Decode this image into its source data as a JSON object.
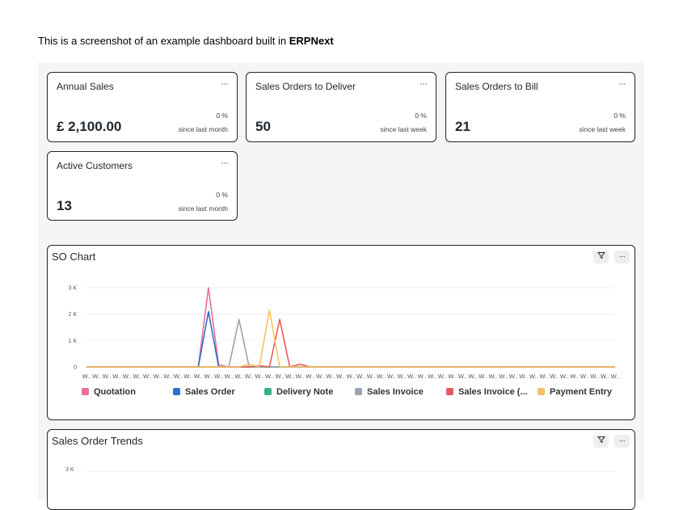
{
  "intro": {
    "prefix": "This is a screenshot of an example dashboard built in ",
    "brand": "ERPNext"
  },
  "cards": [
    {
      "title": "Annual Sales",
      "value": "£ 2,100.00",
      "change": "0 %",
      "period": "since last month",
      "menu": "···"
    },
    {
      "title": "Sales Orders to Deliver",
      "value": "50",
      "change": "0 %",
      "period": "since last week",
      "menu": "···"
    },
    {
      "title": "Sales Orders to Bill",
      "value": "21",
      "change": "0 %",
      "period": "since last week",
      "menu": "···"
    },
    {
      "title": "Active Customers",
      "value": "13",
      "change": "0 %",
      "period": "since last month",
      "menu": "···"
    }
  ],
  "so_chart": {
    "title": "SO Chart",
    "filter_icon": "filter-icon",
    "menu": "···"
  },
  "trends_chart": {
    "title": "Sales Order Trends",
    "filter_icon": "filter-icon",
    "menu": "···",
    "y_tick_visible": "3 K"
  },
  "chart_data": [
    {
      "type": "line",
      "title": "SO Chart",
      "yticks": [
        "0",
        "1 K",
        "2 K",
        "3 K"
      ],
      "ylim": [
        0,
        3000
      ],
      "x": [
        "W..",
        "W..",
        "W..",
        "W..",
        "W..",
        "W..",
        "W..",
        "W..",
        "W..",
        "W..",
        "W..",
        "W..",
        "W..",
        "W..",
        "W..",
        "W..",
        "W..",
        "W..",
        "W..",
        "W..",
        "W..",
        "W..",
        "W..",
        "W..",
        "W..",
        "W..",
        "W..",
        "W..",
        "W..",
        "W..",
        "W..",
        "W..",
        "W..",
        "W..",
        "W..",
        "W..",
        "W..",
        "W..",
        "W..",
        "W..",
        "W..",
        "W..",
        "W..",
        "W..",
        "W..",
        "W..",
        "W..",
        "W..",
        "W..",
        "W..",
        "W..",
        "W..",
        "W.."
      ],
      "grid": true,
      "legend": "bottom",
      "series": [
        {
          "name": "Quotation",
          "color": "#ee6d9e",
          "values": [
            0,
            0,
            0,
            0,
            0,
            0,
            0,
            0,
            0,
            0,
            0,
            0,
            3000,
            80,
            0,
            0,
            0,
            0,
            0,
            0,
            0,
            0,
            0,
            0,
            0,
            0,
            0,
            0,
            0,
            0,
            0,
            0,
            0,
            0,
            0,
            0,
            0,
            0,
            0,
            0,
            0,
            0,
            0,
            0,
            0,
            0,
            0,
            0,
            0,
            0,
            0,
            0,
            0
          ]
        },
        {
          "name": "Sales Order",
          "color": "#2d6fc8",
          "values": [
            0,
            0,
            0,
            0,
            0,
            0,
            0,
            0,
            0,
            0,
            0,
            0,
            2100,
            0,
            0,
            0,
            0,
            0,
            0,
            0,
            0,
            0,
            0,
            0,
            0,
            0,
            0,
            0,
            0,
            0,
            0,
            0,
            0,
            0,
            0,
            0,
            0,
            0,
            0,
            0,
            0,
            0,
            0,
            0,
            0,
            0,
            0,
            0,
            0,
            0,
            0,
            0,
            0
          ]
        },
        {
          "name": "Delivery Note",
          "color": "#36b37e",
          "values": [
            0,
            0,
            0,
            0,
            0,
            0,
            0,
            0,
            0,
            0,
            0,
            0,
            0,
            0,
            0,
            0,
            0,
            0,
            0,
            0,
            0,
            0,
            0,
            0,
            0,
            0,
            0,
            0,
            0,
            0,
            0,
            0,
            0,
            0,
            0,
            0,
            0,
            0,
            0,
            0,
            0,
            0,
            0,
            0,
            0,
            0,
            0,
            0,
            0,
            0,
            0,
            0,
            0
          ]
        },
        {
          "name": "Sales Invoice",
          "color": "#9aa5b1",
          "values": [
            0,
            0,
            0,
            0,
            0,
            0,
            0,
            0,
            0,
            0,
            0,
            0,
            0,
            0,
            0,
            1800,
            0,
            0,
            0,
            0,
            0,
            0,
            0,
            0,
            0,
            0,
            0,
            0,
            0,
            0,
            0,
            0,
            0,
            0,
            0,
            0,
            0,
            0,
            0,
            0,
            0,
            0,
            0,
            0,
            0,
            0,
            0,
            0,
            0,
            0,
            0,
            0,
            0
          ]
        },
        {
          "name": "Sales Invoice (...",
          "color": "#eb5a5a",
          "values": [
            0,
            0,
            0,
            0,
            0,
            0,
            0,
            0,
            0,
            0,
            0,
            0,
            0,
            0,
            0,
            0,
            0,
            50,
            0,
            1800,
            0,
            100,
            0,
            0,
            0,
            0,
            0,
            0,
            0,
            0,
            0,
            0,
            0,
            0,
            0,
            0,
            0,
            0,
            0,
            0,
            0,
            0,
            0,
            0,
            0,
            0,
            0,
            0,
            0,
            0,
            0,
            0,
            0
          ]
        },
        {
          "name": "Payment Entry",
          "color": "#f6c160",
          "values": [
            0,
            0,
            0,
            0,
            0,
            0,
            0,
            0,
            0,
            0,
            0,
            0,
            0,
            0,
            0,
            0,
            100,
            0,
            2150,
            0,
            0,
            0,
            0,
            0,
            0,
            0,
            0,
            0,
            0,
            0,
            0,
            0,
            0,
            0,
            0,
            0,
            0,
            0,
            0,
            0,
            0,
            0,
            0,
            0,
            0,
            0,
            0,
            0,
            0,
            0,
            0,
            0,
            0
          ]
        }
      ]
    }
  ]
}
